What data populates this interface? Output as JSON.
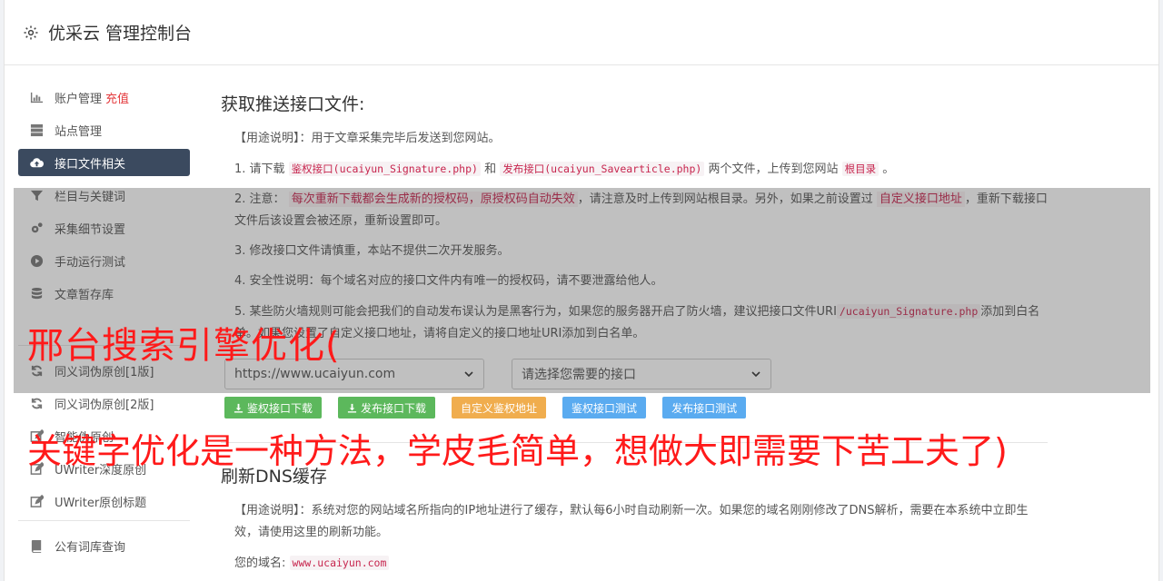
{
  "header": {
    "title": "优采云 管理控制台"
  },
  "sidebar": {
    "items": [
      {
        "label": "账户管理",
        "badge": "充值"
      },
      {
        "label": "站点管理"
      },
      {
        "label": "接口文件相关"
      },
      {
        "label": "栏目与关键词"
      },
      {
        "label": "采集细节设置"
      },
      {
        "label": "手动运行测试"
      },
      {
        "label": "文章暂存库"
      },
      {
        "label": "同义词伪原创[1版]"
      },
      {
        "label": "同义词伪原创[2版]"
      },
      {
        "label": "智能伪原创"
      },
      {
        "label": "UWriter深度原创"
      },
      {
        "label": "UWriter原创标题"
      },
      {
        "label": "公有词库查询"
      }
    ]
  },
  "main": {
    "section1_title": "获取推送接口文件:",
    "usage_label": "【用途说明】",
    "usage_text": "：用于文章采集完毕后发送到您网站。",
    "step1_a": "1. 请下载",
    "step1_code1": "鉴权接口(ucaiyun_Signature.php)",
    "step1_b": "和",
    "step1_code2": "发布接口(ucaiyun_Savearticle.php)",
    "step1_c": "两个文件，上传到您网站",
    "step1_code3": "根目录",
    "step1_d": "。",
    "step2_a": "2. 注意：",
    "step2_red": "每次重新下载都会生成新的授权码，原授权码自动失效",
    "step2_b": "，请注意及时上传到网站根目录。另外，如果之前设置过",
    "step2_red2": "自定义接口地址",
    "step2_c": "，重新下载接口文件后该设置会被还原，重新设置即可。",
    "step3": "3. 修改接口文件请慎重，本站不提供二次开发服务。",
    "step4": "4. 安全性说明：每个域名对应的接口文件内有唯一的授权码，请不要泄露给他人。",
    "step5_a": "5. 某些防火墙规则可能会把我们的自动发布误认为是黑客行为，如果您的服务器开启了防火墙，建议把接口文件URI",
    "step5_code": "/ucaiyun_Signature.php",
    "step5_b": "添加到白名单。如果您设置了自定义接口地址，请将自定义的接口地址URI添加到白名单。",
    "select_site": "https://www.ucaiyun.com",
    "select_api": "请选择您需要的接口",
    "buttons": {
      "download_auth": "鉴权接口下载",
      "download_publish": "发布接口下载",
      "custom_auth": "自定义鉴权地址",
      "test_auth": "鉴权接口测试",
      "test_publish": "发布接口测试"
    },
    "section2_title": "刷新DNS缓存",
    "dns_usage_label": "【用途说明】",
    "dns_usage_text": "：系统对您的网站域名所指向的IP地址进行了缓存，默认每6小时自动刷新一次。如果您的域名刚刚修改了DNS解析，需要在本系统中立即生效，请使用这里的刷新功能。",
    "domain_label": "您的域名:",
    "domain_value": "www.ucaiyun.com"
  },
  "overlay": {
    "line1": "邢台搜索引擎优化(",
    "line2": "关键字优化是一种方法，学皮毛简单，想做大即需要下苦工夫了)"
  },
  "colors": {
    "accent": "#3b4a5f",
    "green": "#5cb85c",
    "orange": "#f0ad4e",
    "blue": "#5aabf0",
    "overlay_text": "#ff1a1a"
  }
}
